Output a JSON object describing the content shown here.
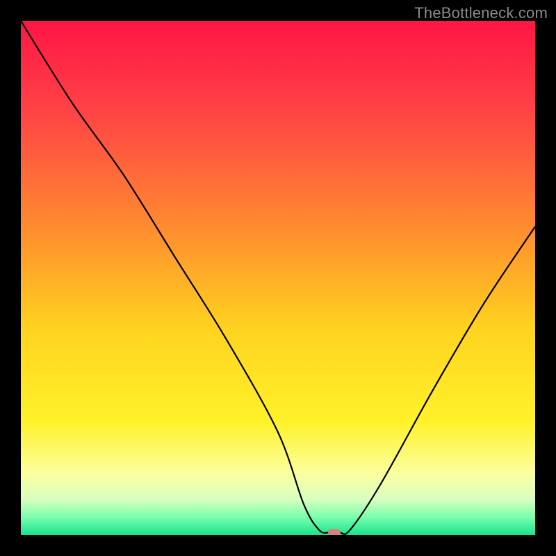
{
  "watermark": "TheBottleneck.com",
  "chart_data": {
    "type": "line",
    "title": "",
    "xlabel": "",
    "ylabel": "",
    "xlim": [
      0,
      100
    ],
    "ylim": [
      0,
      100
    ],
    "grid": false,
    "series": [
      {
        "name": "bottleneck-curve",
        "x": [
          0,
          10,
          20,
          30,
          40,
          50,
          55,
          58,
          60,
          62,
          64,
          70,
          80,
          90,
          100
        ],
        "y": [
          100,
          84,
          70,
          54,
          38,
          20,
          6,
          1,
          0.5,
          0.5,
          1,
          10,
          28,
          45,
          60
        ]
      }
    ],
    "marker": {
      "x": 61,
      "y": 0.5,
      "color": "#d9817b"
    },
    "background_gradient": {
      "stops": [
        {
          "pos": 0.0,
          "color": "#ff1545"
        },
        {
          "pos": 0.18,
          "color": "#ff4445"
        },
        {
          "pos": 0.4,
          "color": "#ff8b2f"
        },
        {
          "pos": 0.6,
          "color": "#ffd31f"
        },
        {
          "pos": 0.78,
          "color": "#fff22a"
        },
        {
          "pos": 0.88,
          "color": "#fbffa0"
        },
        {
          "pos": 0.93,
          "color": "#d9ffc0"
        },
        {
          "pos": 0.965,
          "color": "#7affad"
        },
        {
          "pos": 1.0,
          "color": "#18e28c"
        }
      ]
    },
    "curve_color": "#000000",
    "curve_width": 2.2
  }
}
